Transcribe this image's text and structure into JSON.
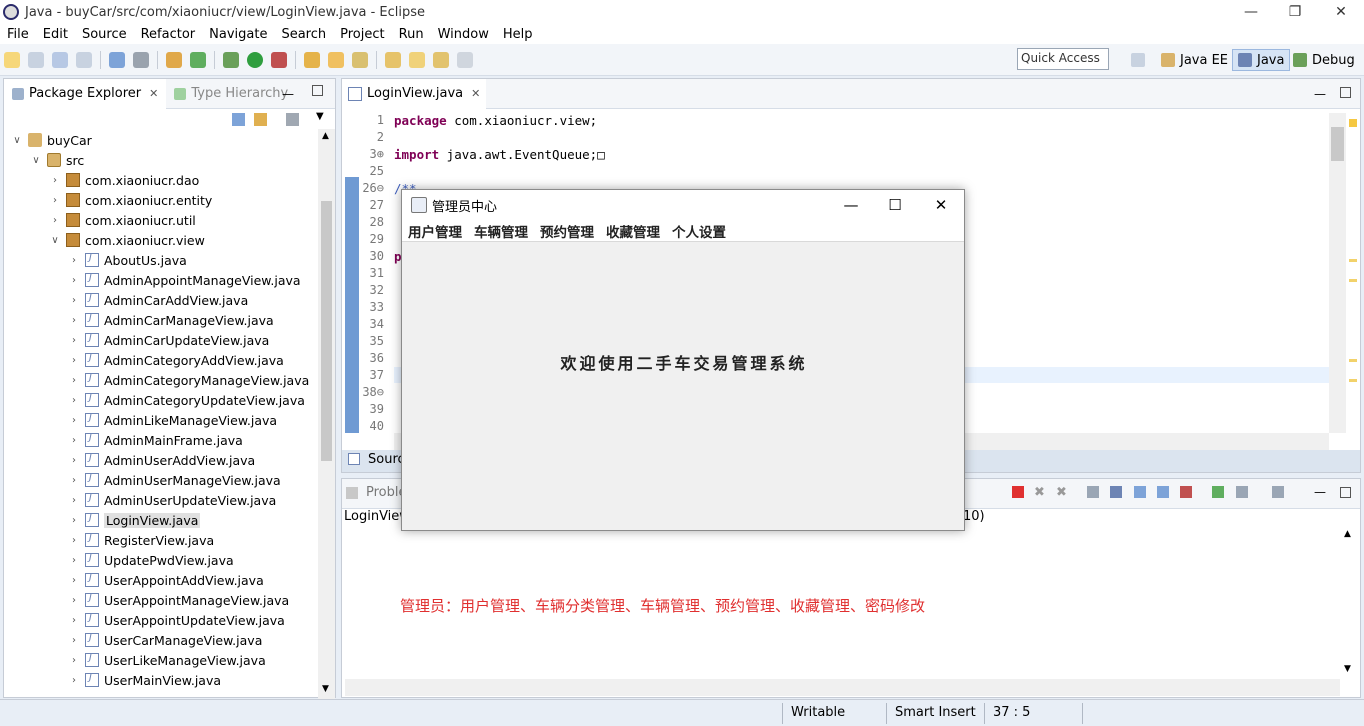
{
  "window": {
    "title": "Java - buyCar/src/com/xiaoniucr/view/LoginView.java - Eclipse"
  },
  "menubar": [
    "File",
    "Edit",
    "Source",
    "Refactor",
    "Navigate",
    "Search",
    "Project",
    "Run",
    "Window",
    "Help"
  ],
  "toolbar": {
    "quick_access": "Quick Access"
  },
  "perspectives": [
    "Java EE",
    "Java",
    "Debug"
  ],
  "explorer": {
    "tab_active": "Package Explorer",
    "tab_other": "Type Hierarchy",
    "tree": [
      {
        "label": "buyCar",
        "level": 0,
        "icon": "project-icon",
        "expanded": true
      },
      {
        "label": "src",
        "level": 1,
        "icon": "source-folder-icon",
        "expanded": true
      },
      {
        "label": "com.xiaoniucr.dao",
        "level": 2,
        "icon": "package-icon",
        "expanded": false
      },
      {
        "label": "com.xiaoniucr.entity",
        "level": 2,
        "icon": "package-icon",
        "expanded": false
      },
      {
        "label": "com.xiaoniucr.util",
        "level": 2,
        "icon": "package-icon",
        "expanded": false
      },
      {
        "label": "com.xiaoniucr.view",
        "level": 2,
        "icon": "package-icon",
        "expanded": true
      },
      {
        "label": "AboutUs.java",
        "level": 3,
        "icon": "java-file-icon"
      },
      {
        "label": "AdminAppointManageView.java",
        "level": 3,
        "icon": "java-file-icon"
      },
      {
        "label": "AdminCarAddView.java",
        "level": 3,
        "icon": "java-file-icon"
      },
      {
        "label": "AdminCarManageView.java",
        "level": 3,
        "icon": "java-file-icon"
      },
      {
        "label": "AdminCarUpdateView.java",
        "level": 3,
        "icon": "java-file-icon"
      },
      {
        "label": "AdminCategoryAddView.java",
        "level": 3,
        "icon": "java-file-icon"
      },
      {
        "label": "AdminCategoryManageView.java",
        "level": 3,
        "icon": "java-file-icon"
      },
      {
        "label": "AdminCategoryUpdateView.java",
        "level": 3,
        "icon": "java-file-icon"
      },
      {
        "label": "AdminLikeManageView.java",
        "level": 3,
        "icon": "java-file-icon"
      },
      {
        "label": "AdminMainFrame.java",
        "level": 3,
        "icon": "java-file-icon"
      },
      {
        "label": "AdminUserAddView.java",
        "level": 3,
        "icon": "java-file-icon"
      },
      {
        "label": "AdminUserManageView.java",
        "level": 3,
        "icon": "java-file-icon"
      },
      {
        "label": "AdminUserUpdateView.java",
        "level": 3,
        "icon": "java-file-icon"
      },
      {
        "label": "LoginView.java",
        "level": 3,
        "icon": "java-file-icon",
        "selected": true
      },
      {
        "label": "RegisterView.java",
        "level": 3,
        "icon": "java-file-icon"
      },
      {
        "label": "UpdatePwdView.java",
        "level": 3,
        "icon": "java-file-icon"
      },
      {
        "label": "UserAppointAddView.java",
        "level": 3,
        "icon": "java-file-icon"
      },
      {
        "label": "UserAppointManageView.java",
        "level": 3,
        "icon": "java-file-icon"
      },
      {
        "label": "UserAppointUpdateView.java",
        "level": 3,
        "icon": "java-file-icon"
      },
      {
        "label": "UserCarManageView.java",
        "level": 3,
        "icon": "java-file-icon"
      },
      {
        "label": "UserLikeManageView.java",
        "level": 3,
        "icon": "java-file-icon"
      },
      {
        "label": "UserMainView.java",
        "level": 3,
        "icon": "java-file-icon"
      }
    ]
  },
  "editor": {
    "tab_label": "LoginView.java",
    "bottom_tab": "Sourc",
    "lines": [
      {
        "no": "1",
        "code": [
          {
            "t": "package",
            "k": "kw"
          },
          {
            "t": " com.xiaoniucr.view;",
            "k": ""
          }
        ]
      },
      {
        "no": "2",
        "code": []
      },
      {
        "no": "3⊕",
        "code": [
          {
            "t": "import",
            "k": "kw"
          },
          {
            "t": " java.awt.EventQueue;□",
            "k": ""
          }
        ]
      },
      {
        "no": "25",
        "code": []
      },
      {
        "no": "26⊖",
        "code": [
          {
            "t": "/**",
            "k": "cm"
          }
        ]
      },
      {
        "no": "27",
        "code": []
      },
      {
        "no": "28",
        "code": []
      },
      {
        "no": "29",
        "code": []
      },
      {
        "no": "30",
        "code": [
          {
            "t": "p",
            "k": "kw"
          }
        ]
      },
      {
        "no": "31",
        "code": []
      },
      {
        "no": "32",
        "code": []
      },
      {
        "no": "33",
        "code": []
      },
      {
        "no": "34",
        "code": []
      },
      {
        "no": "35",
        "code": []
      },
      {
        "no": "36",
        "code": []
      },
      {
        "no": "37",
        "code": []
      },
      {
        "no": "38⊖",
        "code": []
      },
      {
        "no": "39",
        "code": []
      },
      {
        "no": "40",
        "code": []
      }
    ]
  },
  "problems": {
    "tab_label": "Proble",
    "row_left": "LoginView",
    "row_right": "10)",
    "annotation": "管理员：用户管理、车辆分类管理、车辆管理、预约管理、收藏管理、密码修改"
  },
  "status": {
    "writable": "Writable",
    "insert": "Smart Insert",
    "position": "37 : 5"
  },
  "dialog": {
    "title": "管理员中心",
    "menus": [
      "用户管理",
      "车辆管理",
      "预约管理",
      "收藏管理",
      "个人设置"
    ],
    "welcome": "欢迎使用二手车交易管理系统"
  },
  "colors": {
    "accent": "#6f9ad3",
    "annotation": "#e03030",
    "keyword": "#7f0055"
  }
}
